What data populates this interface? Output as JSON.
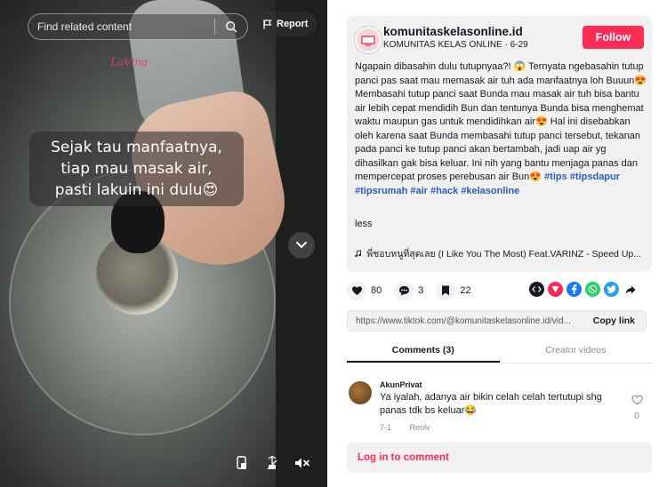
{
  "video": {
    "search_placeholder": "Find related content",
    "report_label": "Report",
    "watermark": "LaVina",
    "caption_lines": [
      "Sejak tau manfaatnya,",
      "tiap mau masak air,",
      "pasti lakuin ini dulu😍"
    ]
  },
  "post": {
    "author_name": "komunitaskelasonline.id",
    "author_sub": "KOMUNITAS KELAS ONLINE · 6-29",
    "follow_label": "Follow",
    "description": "Ngapain dibasahin dulu tutupnyaa?! 😱 Ternyata ngebasahin tutup panci pas saat mau memasak air tuh ada manfaatnya loh Buuun😍 Membasahi tutup panci saat Bunda mau masak air tuh bisa bantu air lebih cepat mendidih Bun dan tentunya Bunda bisa menghemat waktu maupun gas untuk mendidihkan air😍 Hal ini disebabkan oleh karena saat Bunda membasahi tutup panci tersebut, tekanan pada panci ke tutup panci akan bertambah, jadi uap air yg dihasilkan gak bisa keluar. Ini nih yang bantu menjaga panas dan mempercepat proses perebusan air Bun😍",
    "hashtags": [
      "#tips",
      "#tipsdapur",
      "#tipsrumah",
      "#air",
      "#hack",
      "#kelasonline"
    ],
    "less_label": "less",
    "music": "พี่ชอบหนูที่สุดเลย (I Like You The Most) Feat.VARINZ - Speed Up...",
    "likes": "80",
    "comments": "3",
    "saves": "22",
    "link": "https://www.tiktok.com/@komunitaskelasonline.id/vid...",
    "copy_link_label": "Copy link"
  },
  "tabs": {
    "comments": "Comments (3)",
    "creator_videos": "Creator videos"
  },
  "comment": {
    "user": "AkunPrivat",
    "text": "Ya iyalah, adanya air bikin celah celah tertutupi shg panas tdk bs keluar😂",
    "date": "7-1",
    "reply": "Reply",
    "likes": "0"
  },
  "login_label": "Log in to comment",
  "colors": {
    "brand": "#fe2c55",
    "hashtag": "#2b5db9",
    "text": "#161823",
    "card_bg": "#f1f1f2"
  }
}
